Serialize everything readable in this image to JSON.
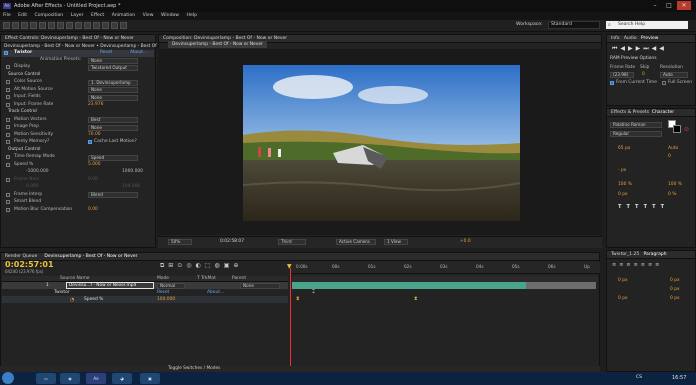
{
  "titlebar": {
    "title": "Adobe After Effects - Untitled Project.aep *",
    "app_icon": "Ae"
  },
  "window_controls": {
    "minimize": "–",
    "maximize": "□",
    "close": "✕"
  },
  "menu": [
    "File",
    "Edit",
    "Composition",
    "Layer",
    "Effect",
    "Animation",
    "View",
    "Window",
    "Help"
  ],
  "toolbar": {
    "workspace_label": "Workspace:",
    "workspace_value": "Standard",
    "search_placeholder": "Search Help"
  },
  "effect_controls": {
    "tab": "Effect Controls: Devinsuperlamp - Best Of - Now or Never",
    "subtitle": "Devinsuperlamp - Best Of - Now or Never • Devinsuperlamp - Best Of",
    "effect_name": "Twixtor",
    "reset": "Reset",
    "about": "About...",
    "animation_presets_label": "Animation Presets:",
    "animation_presets_value": "None",
    "rows": [
      {
        "label": "Display",
        "value": "Twixtored Output",
        "type": "dd"
      },
      {
        "label": "Source Control",
        "value": "",
        "type": "group"
      },
      {
        "label": "Color Source",
        "value": "1. Devinsuperlamp",
        "type": "dd"
      },
      {
        "label": "Alt Motion Source",
        "value": "None",
        "type": "dd"
      },
      {
        "label": "Input: Fields",
        "value": "None",
        "type": "dd"
      },
      {
        "label": "Input: Frame Rate",
        "value": "23.976",
        "type": "num"
      },
      {
        "label": "Track Control",
        "value": "",
        "type": "group"
      },
      {
        "label": "Motion Vectors",
        "value": "Best",
        "type": "dd"
      },
      {
        "label": "Image Prep",
        "value": "None",
        "type": "dd"
      },
      {
        "label": "Motion Sensitivity",
        "value": "70.00",
        "type": "num"
      },
      {
        "label": "Plenty Memory?",
        "value": "Cache Last Motion?",
        "type": "check"
      },
      {
        "label": "Output Control",
        "value": "",
        "type": "group"
      },
      {
        "label": "Time Remap Mode",
        "value": "Speed",
        "type": "dd"
      },
      {
        "label": "Speed %",
        "value": "5.000",
        "type": "num"
      },
      {
        "label": "-1000.000",
        "value": "1000.000",
        "type": "range"
      },
      {
        "label": "Frame Num",
        "value": "0.00",
        "type": "dim"
      },
      {
        "label": "0.000",
        "value": "100.000",
        "type": "dimrange"
      },
      {
        "label": "Frame Interp",
        "value": "Blend",
        "type": "dd"
      },
      {
        "label": "Smart Blend",
        "value": "",
        "type": "check"
      },
      {
        "label": "Motion Blur Compensation",
        "value": "0.00",
        "type": "num"
      }
    ]
  },
  "composition": {
    "tab": "Composition: Devinsuperlamp - Best Of - Now or Never",
    "subtab": "Devinsuperlamp - Best Of - Now or Never",
    "zoom": "50%",
    "timecode": "0:02:58:07",
    "resolution": "Third",
    "camera": "Active Camera",
    "views": "1 View",
    "exposure": "+0.0"
  },
  "preview": {
    "tabs": [
      "Info",
      "Audio",
      "Preview"
    ],
    "ram_options": "RAM Preview Options",
    "frame_rate_label": "Frame Rate",
    "frame_rate_value": "(23.98)",
    "skip_label": "Skip",
    "skip_value": "0",
    "resolution_label": "Resolution",
    "resolution_value": "Auto",
    "from_current": "From Current Time",
    "full_screen": "Full Screen"
  },
  "character": {
    "tabs": [
      "Effects & Presets",
      "Character"
    ],
    "font": "Palatino Roman",
    "style": "Regular",
    "size": "65 px",
    "leading": "Auto",
    "kerning": "0",
    "stroke": "- px",
    "vscale": "100 %",
    "hscale": "100 %",
    "baseline": "0 px",
    "tsume": "0 %"
  },
  "paragraph": {
    "tabs": [
      "Twixtor_1.25",
      "Paragraph"
    ],
    "indent1": "0 px",
    "indent2": "0 px",
    "indent3": "0 px",
    "space1": "0 px",
    "space2": "0 px"
  },
  "render_queue": {
    "tab": "Render Queue",
    "comp_tab": "Devinsuperlamp - Best Of - Now or Never"
  },
  "timeline": {
    "timecode": "0:02:57:01",
    "frame_info": "04240 (23.976 fps)",
    "columns": {
      "source": "Source Name",
      "mode": "Mode",
      "trkmat": "T TrkMat",
      "parent": "Parent"
    },
    "layer": {
      "num": "1",
      "name": "Devinsu...f - Now or Never.mp4",
      "mode": "Normal",
      "parent": "None"
    },
    "effect": {
      "name": "Twixtor",
      "reset": "Reset",
      "about": "About..."
    },
    "property": {
      "name": "Speed %",
      "value": "100.000"
    },
    "ruler": [
      "0:00s",
      "00s",
      "01s",
      "02s",
      "03s",
      "04s",
      "05s",
      "06s",
      "Up"
    ],
    "toggle": "Toggle Switches / Modes"
  },
  "taskbar": {
    "time": "16:57",
    "lang": "CS"
  }
}
